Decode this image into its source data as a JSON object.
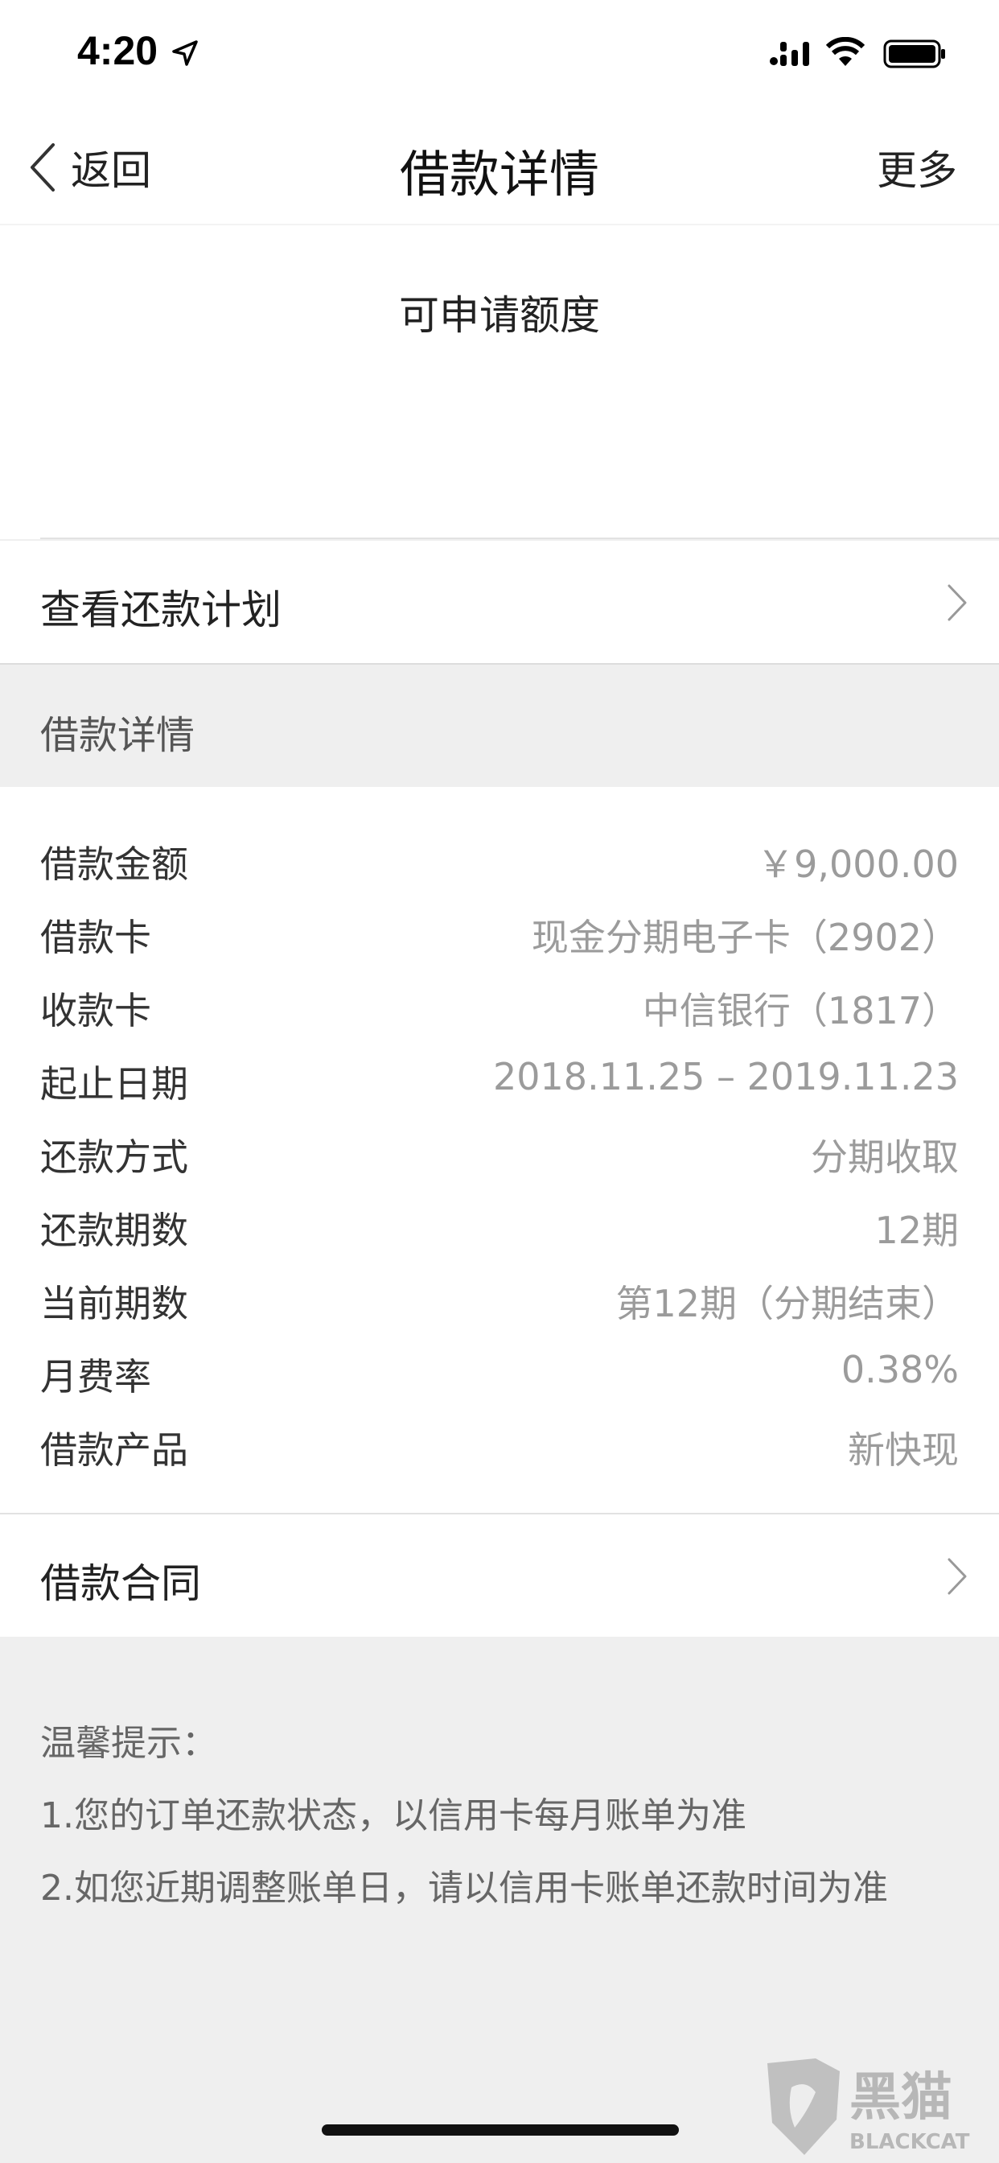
{
  "status_bar": {
    "time": "4:20"
  },
  "nav": {
    "back_label": "返回",
    "title": "借款详情",
    "more_label": "更多"
  },
  "credit": {
    "label": "可申请额度"
  },
  "plan": {
    "label": "查看还款计划"
  },
  "section": {
    "title": "借款详情"
  },
  "details": [
    {
      "label": "借款金额",
      "value": "￥9,000.00"
    },
    {
      "label": "借款卡",
      "value": "现金分期电子卡（2902）"
    },
    {
      "label": "收款卡",
      "value": "中信银行（1817）"
    },
    {
      "label": "起止日期",
      "value": "2018.11.25 – 2019.11.23"
    },
    {
      "label": "还款方式",
      "value": "分期收取"
    },
    {
      "label": "还款期数",
      "value": "12期"
    },
    {
      "label": "当前期数",
      "value": "第12期（分期结束）"
    },
    {
      "label": "月费率",
      "value": "0.38%"
    },
    {
      "label": "借款产品",
      "value": "新快现"
    }
  ],
  "contract": {
    "label": "借款合同"
  },
  "tips": {
    "title": "温馨提示：",
    "line1": "1.您的订单还款状态，以信用卡每月账单为准",
    "line2": "2.如您近期调整账单日，请以信用卡账单还款时间为准"
  },
  "watermark": {
    "text": "黑猫",
    "sub": "BLACKCAT"
  }
}
